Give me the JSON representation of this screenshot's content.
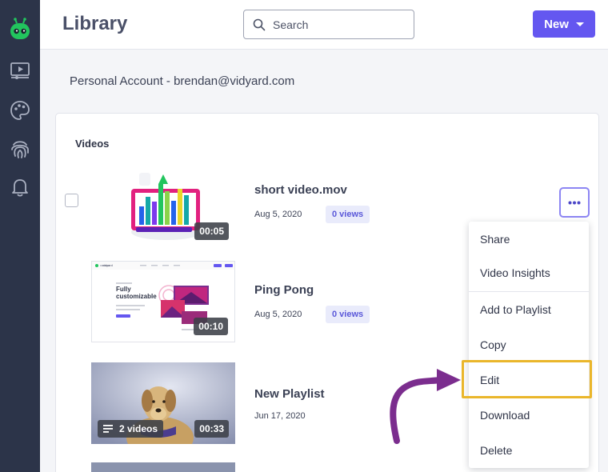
{
  "header": {
    "title": "Library",
    "search_placeholder": "Search",
    "new_label": "New"
  },
  "account_label": "Personal Account - brendan@vidyard.com",
  "section": {
    "heading": "Videos"
  },
  "videos": [
    {
      "title": "short video.mov",
      "date": "Aug 5, 2020",
      "views": "0 views",
      "duration": "00:05"
    },
    {
      "title": "Ping Pong",
      "date": "Aug 5, 2020",
      "views": "0 views",
      "duration": "00:10",
      "thumb_text": "Fully customizable",
      "thumb_brand": "vidyard"
    },
    {
      "title": "New Playlist",
      "date": "Jun 17, 2020",
      "duration": "00:33",
      "playlist_count": "2 videos"
    }
  ],
  "menu": {
    "items": [
      "Share",
      "Video Insights",
      "Add to Playlist",
      "Copy",
      "Edit",
      "Download",
      "Delete"
    ],
    "highlighted": "Edit"
  },
  "colors": {
    "sidebar": "#2c3449",
    "accent": "#6457f0",
    "highlight": "#eab62b",
    "arrow": "#7b2d8e",
    "logo": "#22c55e"
  },
  "icons": {
    "logo": "vidyard-robot-icon",
    "nav": [
      "video-player-icon",
      "palette-icon",
      "fingerprint-icon",
      "bell-icon"
    ]
  }
}
